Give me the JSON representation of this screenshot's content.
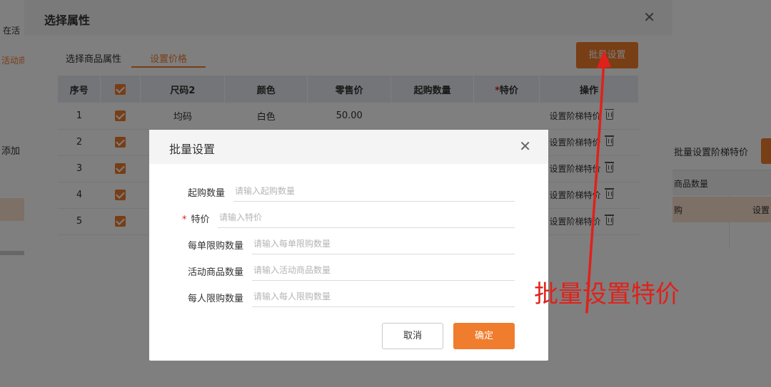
{
  "background": {
    "left_texts": [
      "在活",
      "活动商",
      "添加"
    ],
    "right_text": "批量设置阶梯特价",
    "right_table_header": "商品数量",
    "right_row": [
      "购",
      "设置"
    ]
  },
  "modal1": {
    "title": "选择属性",
    "tabs": [
      {
        "label": "选择商品属性"
      },
      {
        "label": "设置价格"
      }
    ],
    "batch_button": "批量设置",
    "table": {
      "headers": {
        "seq": "序号",
        "size": "尺码2",
        "color": "颜色",
        "retail": "零售价",
        "min_qty": "起购数量",
        "special_star": "*",
        "special": "特价",
        "op": "操作"
      },
      "rows": [
        {
          "seq": "1",
          "size": "均码",
          "color": "白色",
          "retail": "50.00",
          "op": "设置阶梯特价"
        },
        {
          "seq": "2",
          "size": "",
          "color": "",
          "retail": "",
          "op": "设置阶梯特价"
        },
        {
          "seq": "3",
          "size": "",
          "color": "",
          "retail": "",
          "op": "设置阶梯特价"
        },
        {
          "seq": "4",
          "size": "",
          "color": "",
          "retail": "",
          "op": "设置阶梯特价"
        },
        {
          "seq": "5",
          "size": "",
          "color": "",
          "retail": "",
          "op": "设置阶梯特价"
        }
      ]
    }
  },
  "modal2": {
    "title": "批量设置",
    "fields": [
      {
        "label": "起购数量",
        "placeholder": "请输入起购数量",
        "required": false
      },
      {
        "label": "特价",
        "placeholder": "请输入特价",
        "required": true
      },
      {
        "label": "每单限购数量",
        "placeholder": "请输入每单限购数量",
        "required": false
      },
      {
        "label": "活动商品数量",
        "placeholder": "请输入活动商品数量",
        "required": false
      },
      {
        "label": "每人限购数量",
        "placeholder": "请输入每人限购数量",
        "required": false
      }
    ],
    "required_mark": "*",
    "cancel_label": "取消",
    "confirm_label": "确定"
  },
  "annotation": {
    "text": "批量设置特价",
    "color": "#e0211b"
  },
  "colors": {
    "accent": "#f07c2d",
    "required": "#e0211b"
  }
}
